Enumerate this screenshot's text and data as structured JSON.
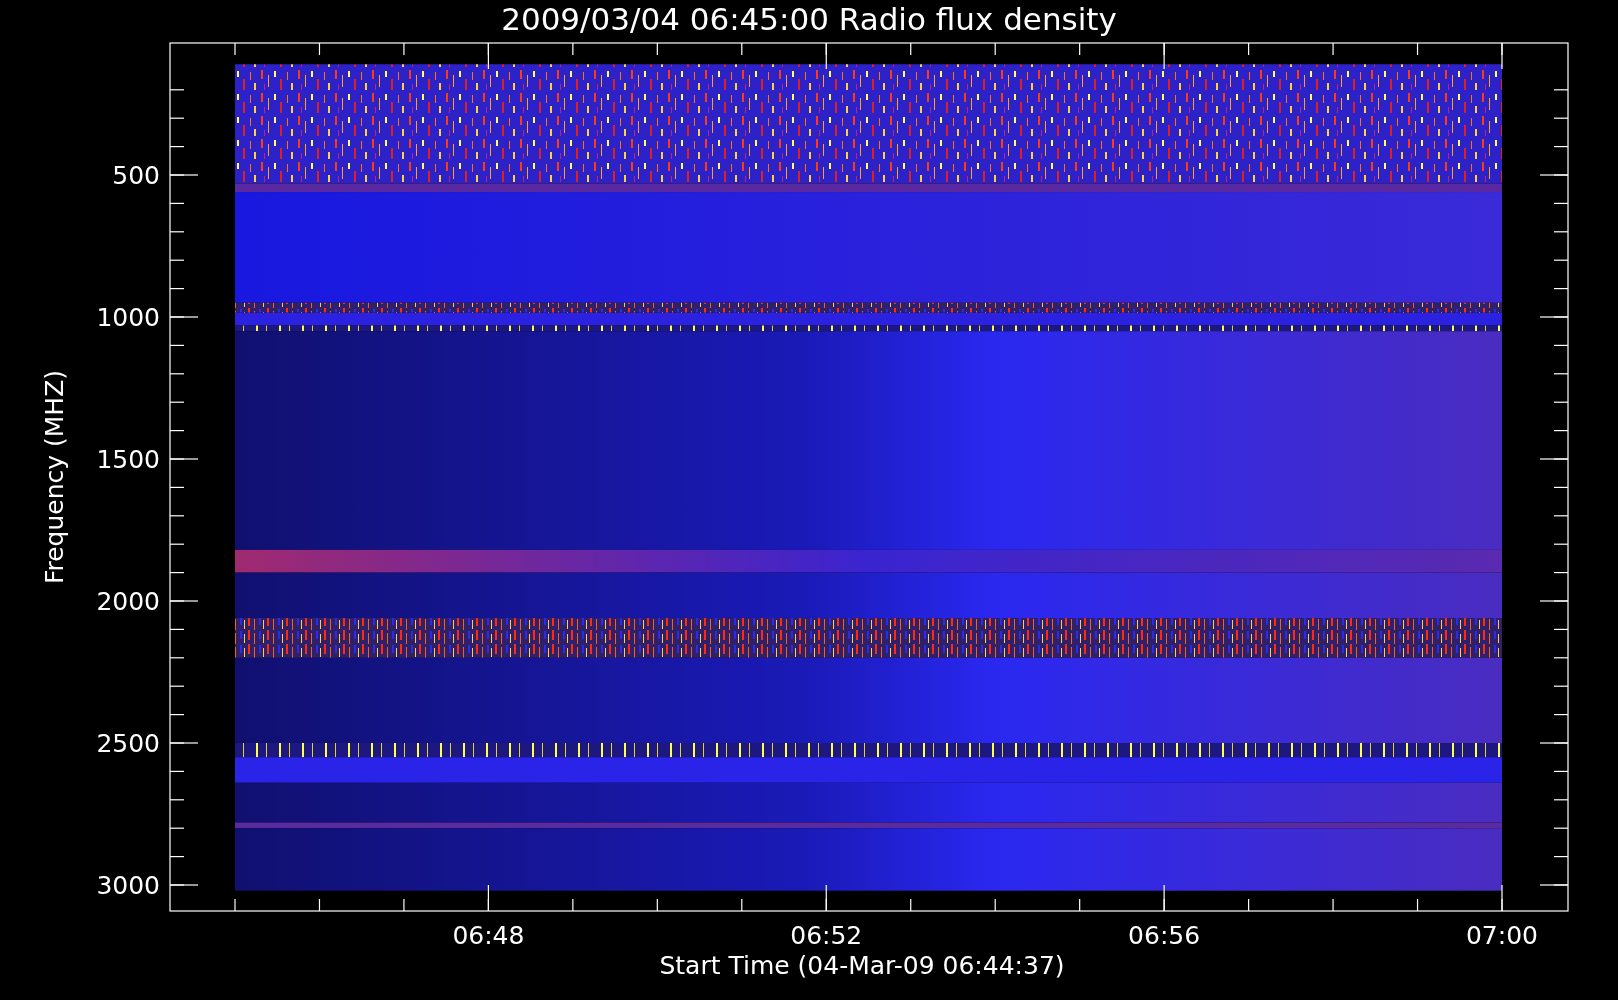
{
  "title": "2009/03/04 06:45:00 Radio flux density",
  "y_axis": {
    "label": "Frequency (MHZ)",
    "ticks": [
      "500",
      "1000",
      "1500",
      "2000",
      "2500",
      "3000"
    ]
  },
  "x_axis": {
    "label": "Start Time (04-Mar-09 06:44:37)",
    "ticks": [
      "06:48",
      "06:52",
      "06:56",
      "07:00"
    ]
  }
}
